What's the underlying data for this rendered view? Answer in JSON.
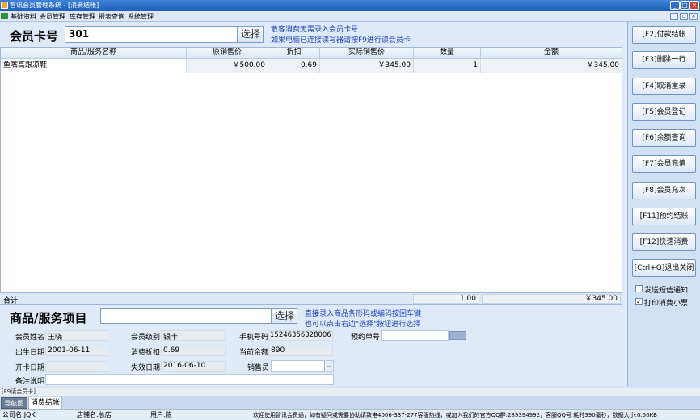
{
  "window": {
    "title": "智讯会员管理系统 - [消费结帐]"
  },
  "menu": [
    "基础资料",
    "会员管理",
    "库存管理",
    "报表查询",
    "系统管理"
  ],
  "card": {
    "label": "会员卡号",
    "value": "301",
    "select_label": "选择"
  },
  "hints": {
    "line1": "散客消费无需录入会员卡号",
    "line2": "如果电脑已连接读写器请按F9进行读会员卡"
  },
  "table": {
    "headers": [
      "商品/服务名称",
      "原销售价",
      "折扣",
      "实际销售价",
      "数量",
      "金额"
    ],
    "rows": [
      [
        "鱼嘴高跟凉鞋",
        "￥500.00",
        "0.69",
        "￥345.00",
        "1",
        "￥345.00"
      ]
    ],
    "total": {
      "label": "合计",
      "quantity": "1.00",
      "amount": "￥345.00"
    }
  },
  "product": {
    "label": "商品/服务项目",
    "select_label": "选择",
    "hint1": "直接录入商品条形码或编码按回车键",
    "hint2": "也可以点击右边\"选择\"按钮进行选择"
  },
  "member": {
    "name_label": "会员姓名",
    "name": "王晓",
    "level_label": "会员级别",
    "level": "银卡",
    "phone_label": "手机号码",
    "phone": "15246356328006",
    "booking_label": "预约单号",
    "birth_label": "出生日期",
    "birth": "2001-06-11",
    "discount_label": "消费折扣",
    "discount": "0.69",
    "balance_label": "当前余额",
    "balance": "890",
    "open_label": "开卡日期",
    "open": "",
    "expire_label": "失效日期",
    "expire": "2016-06-10",
    "seller_label": "销售员",
    "remark_label": "备注说明"
  },
  "actions": [
    "[F2]付款结帐",
    "[F3]删除一行",
    "[F4]取消重录",
    "[F5]会员登记",
    "[F6]余额查询",
    "[F7]会员充值",
    "[F8]会员充次",
    "[F11]预约结账",
    "[F12]快速消费",
    "[Ctrl+Q]退出关闭"
  ],
  "options": {
    "sms": "发送短信通知",
    "print": "打印消费小票"
  },
  "f9_label": "[F9读会员卡]",
  "tabs": [
    "导航图",
    "消费结帐"
  ],
  "status": {
    "company": "公司名:JQK",
    "store": "店铺名:总店",
    "user": "用户:陈",
    "message": "欢迎使用智讯会员通，如有疑问或需要协助请致电4006-337-277客服热线，或加入我们的官方QQ群:289394992，客服QQ号 耗时390毫秒，数据大小:0.56KB"
  },
  "colors": {
    "accent": "#1d5fb8",
    "hint": "#1c3fbf"
  }
}
